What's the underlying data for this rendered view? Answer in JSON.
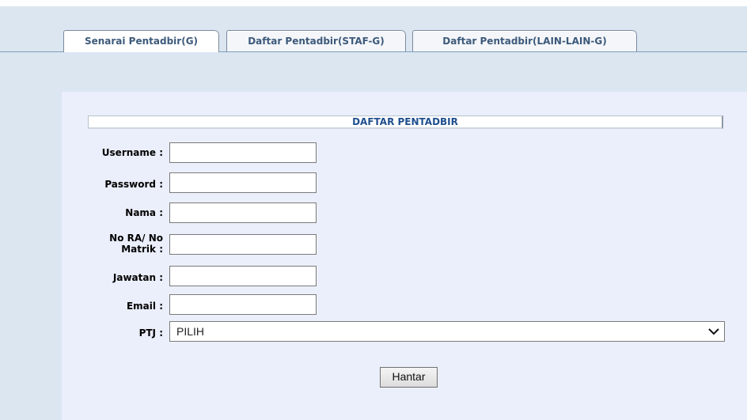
{
  "tabs": [
    {
      "label": "Senarai Pentadbir(G)"
    },
    {
      "label": "Daftar Pentadbir(STAF-G)"
    },
    {
      "label": "Daftar Pentadbir(LAIN-LAIN-G)"
    }
  ],
  "form": {
    "title": "DAFTAR PENTADBIR",
    "fields": {
      "username": {
        "label": "Username :",
        "value": ""
      },
      "password": {
        "label": "Password :",
        "value": ""
      },
      "nama": {
        "label": "Nama :",
        "value": ""
      },
      "no_ra": {
        "label_line1": "No RA/ No",
        "label_line2": "Matrik :",
        "value": ""
      },
      "jawatan": {
        "label": "Jawatan :",
        "value": ""
      },
      "email": {
        "label": "Email :",
        "value": ""
      },
      "ptj": {
        "label": "PTJ :",
        "selected": "PILIH"
      }
    },
    "submit_label": "Hantar"
  }
}
